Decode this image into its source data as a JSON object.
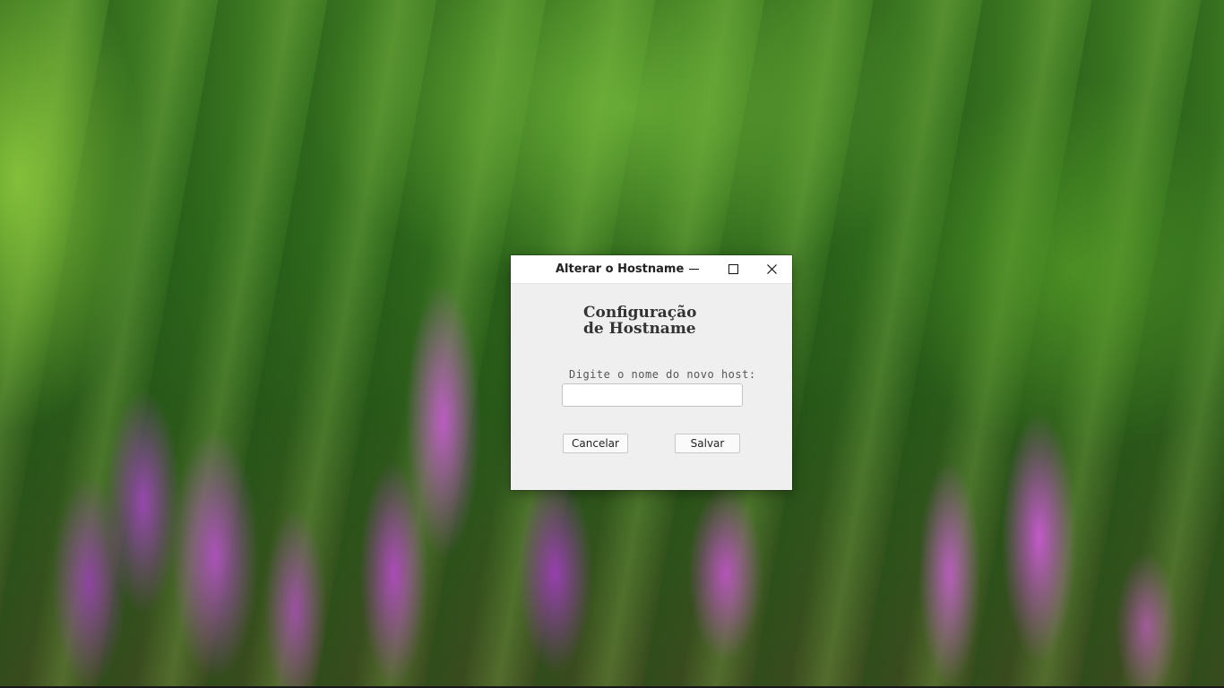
{
  "window": {
    "title": "Alterar o Hostname",
    "minimize_icon": "minimize-icon",
    "maximize_icon": "maximize-icon",
    "close_icon": "close-icon"
  },
  "content": {
    "heading_line1": "Configuração",
    "heading_line2": "de Hostname",
    "prompt": "Digite o nome do novo host:",
    "hostname_input": {
      "value": "",
      "placeholder": ""
    }
  },
  "buttons": {
    "cancel_label": "Cancelar",
    "save_label": "Salvar"
  }
}
